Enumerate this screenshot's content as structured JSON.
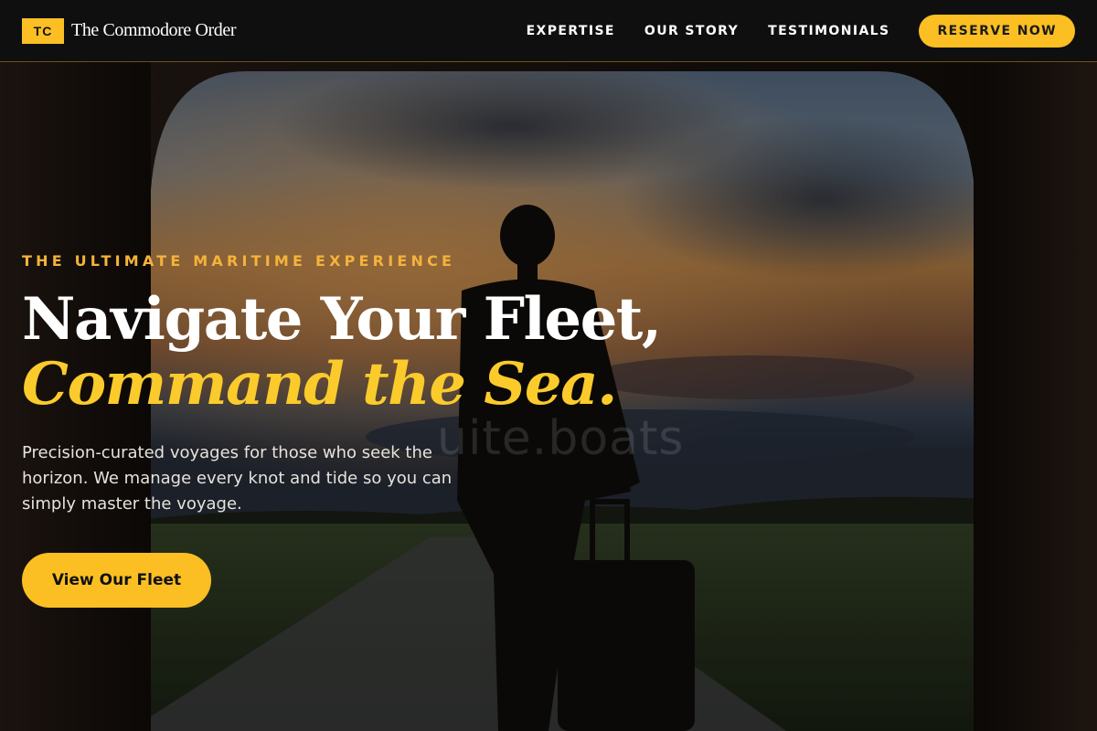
{
  "nav": {
    "logo_initials": "TC",
    "brand_name": "The Commodore Order",
    "links": [
      {
        "label": "EXPERTISE"
      },
      {
        "label": "OUR STORY"
      },
      {
        "label": "TESTIMONIALS"
      }
    ],
    "cta_label": "RESERVE NOW"
  },
  "hero": {
    "eyebrow": "THE ULTIMATE MARITIME EXPERIENCE",
    "headline_line1": "Navigate Your Fleet,",
    "headline_line2": "Command the Sea.",
    "subtitle": "Precision-curated voyages for those who seek the horizon. We manage every knot and tide so you can simply master the voyage.",
    "cta_label": "View Our Fleet",
    "watermark": "uite.boats"
  },
  "colors": {
    "accent": "#fbbf24",
    "headline_accent": "#fbcb2c",
    "eyebrow": "#f5b33a",
    "nav_bg": "#0f0f0f"
  }
}
